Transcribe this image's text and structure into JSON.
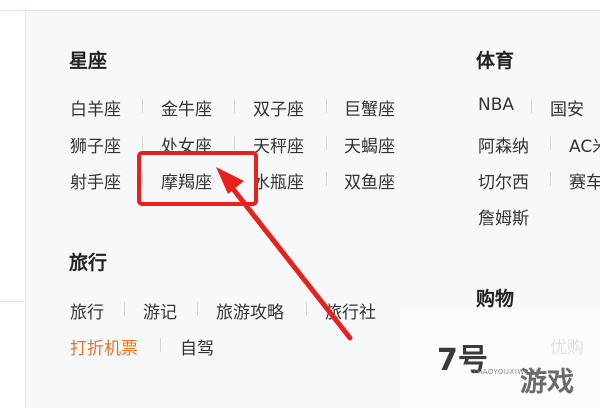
{
  "constellation": {
    "title": "星座",
    "items": [
      "白羊座",
      "金牛座",
      "双子座",
      "巨蟹座",
      "狮子座",
      "处女座",
      "天秤座",
      "天蝎座",
      "射手座",
      "摩羯座",
      "水瓶座",
      "双鱼座"
    ]
  },
  "sports": {
    "title": "体育",
    "items": [
      "NBA",
      "国安",
      "阿森纳",
      "AC米",
      "切尔西",
      "赛车",
      "詹姆斯"
    ]
  },
  "travel": {
    "title": "旅行",
    "items": [
      "旅行",
      "游记",
      "旅游攻略",
      "旅行社",
      "打折机票",
      "自驾"
    ]
  },
  "shopping": {
    "title": "购物",
    "items": [
      "优购"
    ]
  },
  "watermark": {
    "logo": "7号",
    "site": "7HAOYOUXIWANG",
    "game": "游戏"
  },
  "colors": {
    "accent_orange": "#e8742a",
    "highlight_red": "#e8211c"
  }
}
